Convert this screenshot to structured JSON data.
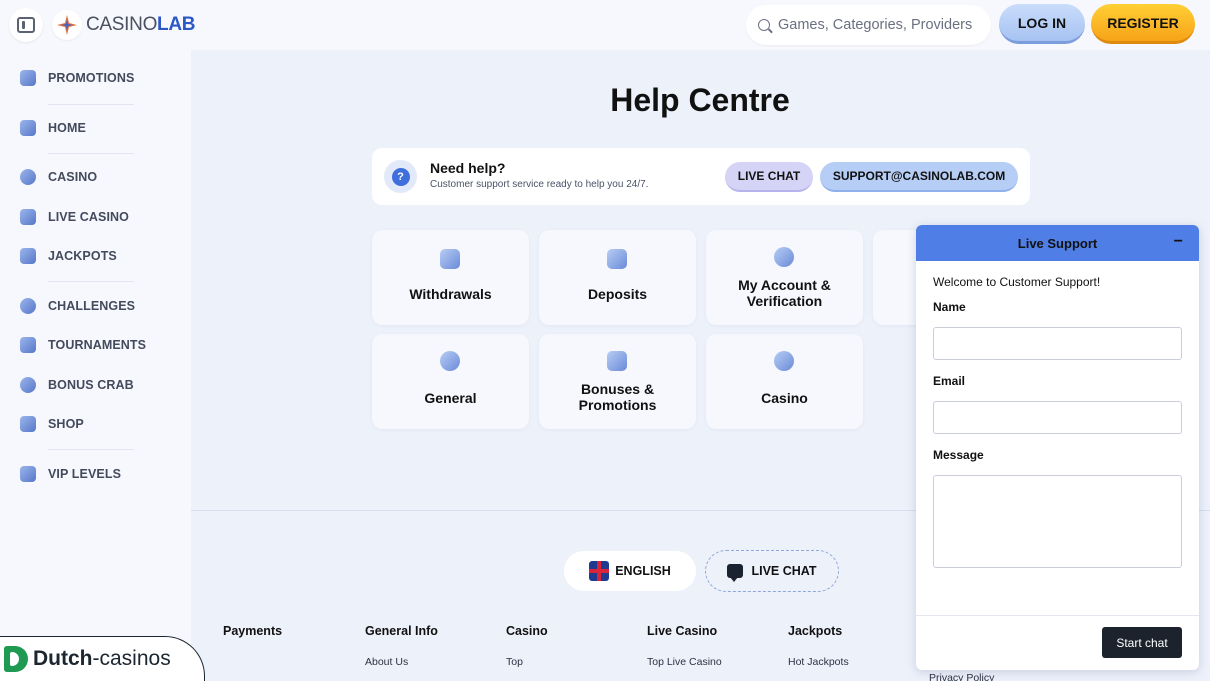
{
  "header": {
    "logo_text_light": "CASINO",
    "logo_text_bold": "LAB",
    "search_placeholder": "Games, Categories, Providers",
    "login_label": "LOG IN",
    "register_label": "REGISTER"
  },
  "sidebar": {
    "items": [
      {
        "label": "PROMOTIONS",
        "icon": "megaphone-icon"
      },
      {
        "label": "HOME",
        "icon": "home-icon"
      },
      {
        "label": "CASINO",
        "icon": "casino-chip-icon"
      },
      {
        "label": "LIVE CASINO",
        "icon": "live-casino-icon"
      },
      {
        "label": "JACKPOTS",
        "icon": "jackpot-icon"
      },
      {
        "label": "CHALLENGES",
        "icon": "challenges-icon"
      },
      {
        "label": "TOURNAMENTS",
        "icon": "trophy-icon"
      },
      {
        "label": "BONUS CRAB",
        "icon": "crab-icon"
      },
      {
        "label": "SHOP",
        "icon": "shop-icon"
      },
      {
        "label": "VIP LEVELS",
        "icon": "crown-icon"
      }
    ]
  },
  "main": {
    "title": "Help Centre",
    "help_banner": {
      "title": "Need help?",
      "subtitle": "Customer support service ready to help you 24/7.",
      "live_chat_label": "LIVE CHAT",
      "email_label": "SUPPORT@CASINOLAB.COM"
    },
    "categories": [
      {
        "label": "Withdrawals",
        "icon": "withdrawals-icon"
      },
      {
        "label": "Deposits",
        "icon": "deposits-icon"
      },
      {
        "label": "My Account & Verification",
        "icon": "account-icon"
      },
      {
        "label": "General",
        "icon": "question-icon"
      },
      {
        "label": "Bonuses & Promotions",
        "icon": "gift-icon"
      },
      {
        "label": "Casino",
        "icon": "casino-chip-icon"
      }
    ]
  },
  "footer": {
    "language_label": "ENGLISH",
    "live_chat_label": "LIVE CHAT",
    "columns": [
      {
        "title": "Payments",
        "link": ""
      },
      {
        "title": "General Info",
        "link": "About Us"
      },
      {
        "title": "Casino",
        "link": "Top"
      },
      {
        "title": "Live Casino",
        "link": "Top Live Casino"
      },
      {
        "title": "Jackpots",
        "link": "Hot Jackpots"
      }
    ],
    "privacy_link": "Privacy Policy"
  },
  "widget": {
    "title": "Live Support",
    "minimize_glyph": "−",
    "welcome": "Welcome to Customer Support!",
    "name_label": "Name",
    "email_label": "Email",
    "message_label": "Message",
    "start_label": "Start chat"
  },
  "watermark": {
    "bold": "Dutch",
    "light": "-casinos"
  }
}
